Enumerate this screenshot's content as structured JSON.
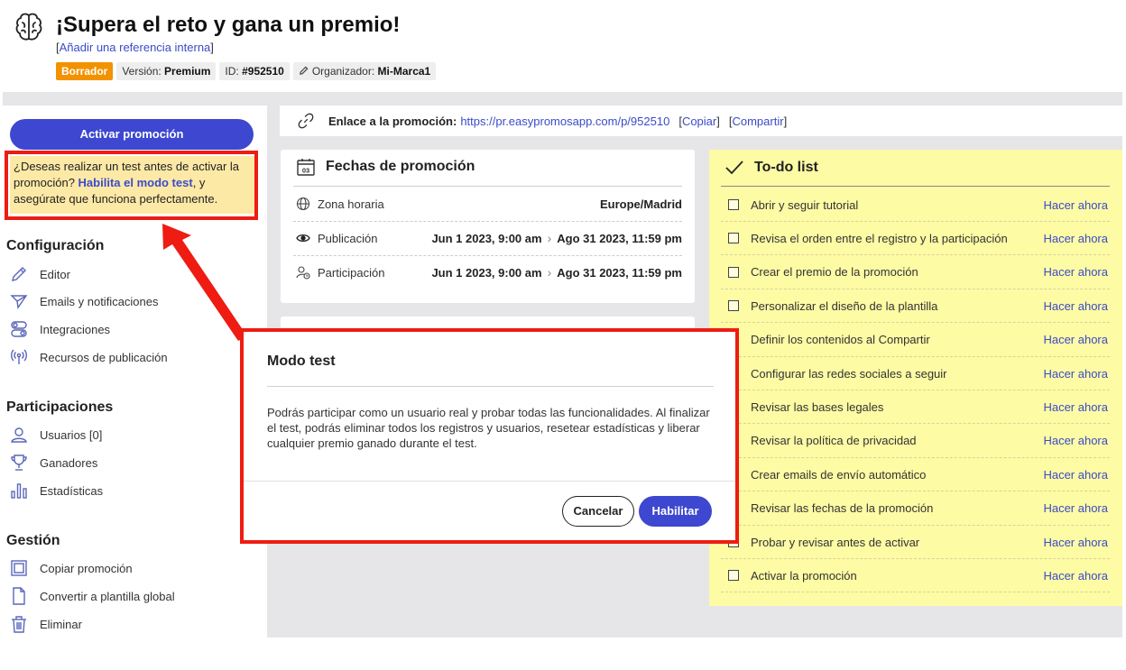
{
  "header": {
    "title": "¡Supera el reto y gana un premio!",
    "ref_open": "[",
    "ref_link": "Añadir una referencia interna",
    "ref_close": "]",
    "badges": {
      "status": "Borrador",
      "version_label": "Versión:",
      "version_value": "Premium",
      "id_label": "ID:",
      "id_value": "#952510",
      "organizer_label": "Organizador:",
      "organizer_value": "Mi-Marca1"
    },
    "status_color": "#f39200"
  },
  "sidebar": {
    "activate_button": "Activar promoción",
    "test_prompt": {
      "before": "¿Deseas realizar un test antes de activar la promoción? ",
      "link": "Habilita el modo test",
      "after": ", y asegúrate que funciona perfectamente."
    },
    "sections": [
      {
        "title": "Configuración",
        "items": [
          {
            "label": "Editor",
            "icon": "pencil-icon"
          },
          {
            "label": "Emails y notificaciones",
            "icon": "paper-plane-icon"
          },
          {
            "label": "Integraciones",
            "icon": "toggles-icon"
          },
          {
            "label": "Recursos de publicación",
            "icon": "broadcast-icon"
          }
        ]
      },
      {
        "title": "Participaciones",
        "items": [
          {
            "label": "Usuarios [0]",
            "icon": "user-icon"
          },
          {
            "label": "Ganadores",
            "icon": "trophy-icon"
          },
          {
            "label": "Estadísticas",
            "icon": "bar-chart-icon"
          }
        ]
      },
      {
        "title": "Gestión",
        "items": [
          {
            "label": "Copiar promoción",
            "icon": "copy-icon"
          },
          {
            "label": "Convertir a plantilla global",
            "icon": "document-icon"
          },
          {
            "label": "Eliminar",
            "icon": "trash-icon"
          }
        ]
      }
    ]
  },
  "linkbar": {
    "label": "Enlace a la promoción:",
    "url": "https://pr.easypromosapp.com/p/952510",
    "copy": "Copiar",
    "share": "Compartir"
  },
  "dates": {
    "title": "Fechas de promoción",
    "rows": [
      {
        "label": "Zona horaria",
        "value": "Europe/Madrid",
        "icon": "globe-icon"
      },
      {
        "label": "Publicación",
        "start": "Jun 1 2023, 9:00 am",
        "end": "Ago 31 2023, 11:59 pm",
        "icon": "eye-icon"
      },
      {
        "label": "Participación",
        "start": "Jun 1 2023, 9:00 am",
        "end": "Ago 31 2023, 11:59 pm",
        "icon": "user-clock-icon"
      }
    ],
    "separator": "›"
  },
  "todo": {
    "title": "To-do list",
    "action": "Hacer ahora",
    "items": [
      "Abrir y seguir tutorial",
      "Revisa el orden entre el registro y la participación",
      "Crear el premio de la promoción",
      "Personalizar el diseño de la plantilla",
      "Definir los contenidos al Compartir",
      "Configurar las redes sociales a seguir",
      "Revisar las bases legales",
      "Revisar la política de privacidad",
      "Crear emails de envío automático",
      "Revisar las fechas de la promoción",
      "Probar y revisar antes de activar",
      "Activar la promoción"
    ]
  },
  "modal": {
    "title": "Modo test",
    "body": "Podrás participar como un usuario real y probar todas las funcionalidades. Al finalizar el test, podrás eliminar todos los registros y usuarios, resetear estadísticas y liberar cualquier premio ganado durante el test.",
    "cancel": "Cancelar",
    "confirm": "Habilitar"
  },
  "colors": {
    "primary": "#3d47cf",
    "link": "#3b4bc8",
    "todo_bg": "#fdfba4",
    "annotation_red": "#ee1c12"
  }
}
